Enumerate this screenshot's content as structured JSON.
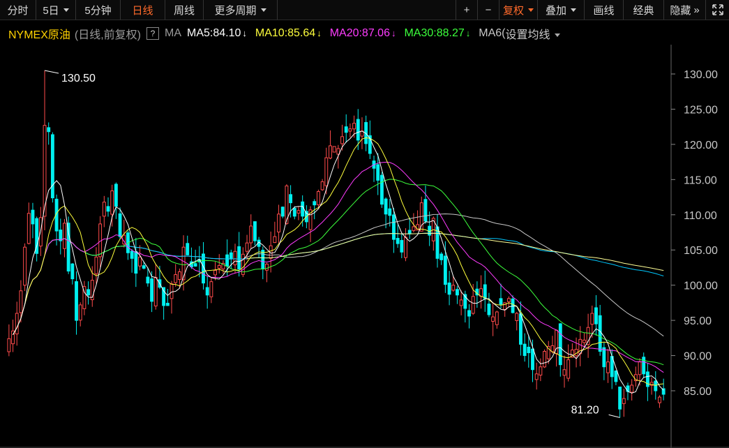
{
  "toolbar": {
    "left": [
      {
        "label": "分时",
        "caret": false,
        "active": false
      },
      {
        "label": "5日",
        "caret": true,
        "active": false
      },
      {
        "label": "5分钟",
        "caret": false,
        "active": false
      },
      {
        "label": "日线",
        "caret": false,
        "active": true
      },
      {
        "label": "周线",
        "caret": false,
        "active": false
      },
      {
        "label": "更多周期",
        "caret": true,
        "active": false
      }
    ],
    "right": [
      {
        "label": "+",
        "caret": false,
        "active": false
      },
      {
        "label": "−",
        "caret": false,
        "active": false
      },
      {
        "label": "复权",
        "caret": true,
        "active": true
      },
      {
        "label": "叠加",
        "caret": true,
        "active": false
      },
      {
        "label": "画线",
        "caret": false,
        "active": false
      },
      {
        "label": "经典",
        "caret": false,
        "active": false
      },
      {
        "label": "隐藏",
        "caret": false,
        "active": false
      }
    ]
  },
  "legend": {
    "title": "NYMEX原油",
    "subtitle": "(日线,前复权)",
    "help": "?",
    "ma_label": "MA",
    "ma_items": [
      {
        "text": "MA5:84.10",
        "color": "#ffffff"
      },
      {
        "text": "MA10:85.64",
        "color": "#ffff3c"
      },
      {
        "text": "MA20:87.06",
        "color": "#ff3cff"
      },
      {
        "text": "MA30:88.27",
        "color": "#3cff3c"
      },
      {
        "text": "MA6(",
        "color": "#c8c8c8"
      }
    ],
    "setting_label": "设置均线"
  },
  "chart_data": {
    "type": "candlestick",
    "title": "NYMEX原油",
    "ylim": [
      79.5,
      133
    ],
    "yticks": [
      "130.00",
      "125.00",
      "120.00",
      "115.00",
      "110.00",
      "105.00",
      "100.00",
      "95.00",
      "90.00",
      "85.00"
    ],
    "colors": {
      "up": "#ff4b4b",
      "down": "#00f0f0",
      "ma5": "#ffffff",
      "ma10": "#ffff3c",
      "ma20": "#ff3cff",
      "ma30": "#3cff3c",
      "ma60": "#c8c8c8",
      "ma120": "#00c8ff",
      "ma250": "#ffff96"
    },
    "annotations": [
      {
        "text": "130.50",
        "value": 130.5
      },
      {
        "text": "81.20",
        "value": 81.2
      }
    ],
    "close": [
      92.4,
      93.5,
      96.0,
      99.2,
      105.4,
      110.2,
      108.7,
      104.5,
      109.6,
      122.7,
      121.8,
      112.4,
      107.7,
      106.3,
      108.8,
      102.0,
      100.9,
      95.0,
      97.2,
      99.8,
      98.6,
      100.7,
      104.0,
      108.7,
      111.8,
      110.5,
      113.4,
      111.2,
      106.9,
      107.1,
      104.6,
      103.8,
      101.7,
      104.0,
      102.4,
      100.3,
      97.7,
      101.1,
      99.7,
      97.1,
      97.1,
      100.2,
      101.5,
      101.9,
      105.4,
      104.3,
      102.6,
      102.7,
      103.3,
      100.3,
      98.6,
      100.5,
      102.1,
      102.8,
      103.1,
      102.7,
      103.8,
      104.8,
      102.3,
      104.4,
      106.0,
      108.4,
      106.3,
      105.5,
      102.3,
      103.0,
      105.6,
      106.9,
      110.1,
      109.8,
      114.1,
      111.7,
      109.8,
      110.6,
      109.8,
      109.0,
      110.7,
      111.4,
      113.3,
      114.7,
      118.1,
      119.8,
      119.7,
      119.4,
      121.1,
      121.7,
      122.2,
      123.0,
      120.6,
      121.9,
      120.1,
      118.7,
      116.6,
      114.9,
      111.5,
      110.1,
      109.9,
      106.5,
      105.9,
      104.7,
      106.8,
      107.3,
      108.3,
      108.6,
      111.7,
      109.1,
      107.1,
      109.5,
      103.8,
      103.6,
      100.1,
      98.7,
      100.0,
      98.6,
      97.9,
      96.7,
      95.6,
      98.4,
      98.6,
      99.5,
      98.1,
      95.8,
      95.5,
      96.2,
      97.3,
      97.5,
      98.1,
      96.1,
      96.0,
      91.6,
      90.0,
      90.4,
      88.0,
      87.4,
      88.4,
      90.6,
      91.3,
      91.4,
      93.6,
      88.7,
      88.0,
      89.4,
      90.8,
      90.9,
      92.3,
      92.2,
      94.0,
      96.0,
      94.5,
      90.6,
      88.4,
      89.1,
      87.0,
      86.3,
      82.4,
      83.9,
      84.9,
      85.8,
      87.3,
      89.1,
      87.4,
      85.6,
      86.2,
      85.0,
      84.1,
      84.5
    ],
    "ma5_last": 84.1,
    "ma10_last": 85.64,
    "ma20_last": 87.06,
    "ma30_last": 88.27
  }
}
